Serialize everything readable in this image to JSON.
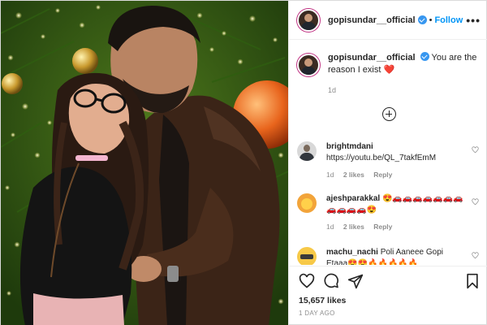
{
  "post": {
    "username": "gopisundar__official",
    "follow_label": "Follow",
    "separator": "•",
    "more_label": "•••",
    "caption_text": " You are the reason I exist ",
    "caption_emoji": "❤️",
    "caption_time": "1d",
    "likes": "15,657 likes",
    "age": "1 DAY AGO"
  },
  "comments": [
    {
      "username": "brightmdani",
      "text": "https://youtu.be/QL_7takfEmM",
      "time": "1d",
      "likes": "2 likes",
      "reply": "Reply"
    },
    {
      "username": "ajeshparakkal",
      "text": "😍🚗🚗🚗🚗🚗🚗🚗🚗🚗🚗🚗😍",
      "time": "1d",
      "likes": "2 likes",
      "reply": "Reply"
    },
    {
      "username": "machu_nachi",
      "text": "Poli Aaneee Gopi Etaaa😍😍🔥🔥🔥🔥🔥",
      "time": "",
      "likes": "",
      "reply": ""
    }
  ],
  "icons": {
    "verified": "verified-badge-icon",
    "like": "heart-outline-icon",
    "comment": "comment-bubble-icon",
    "share": "paper-plane-icon",
    "save": "bookmark-icon",
    "load_more": "plus-circle-icon"
  },
  "colors": {
    "follow": "#0095f6",
    "verified": "#3897f0",
    "muted": "#8e8e8e",
    "border": "#dbdbdb"
  }
}
